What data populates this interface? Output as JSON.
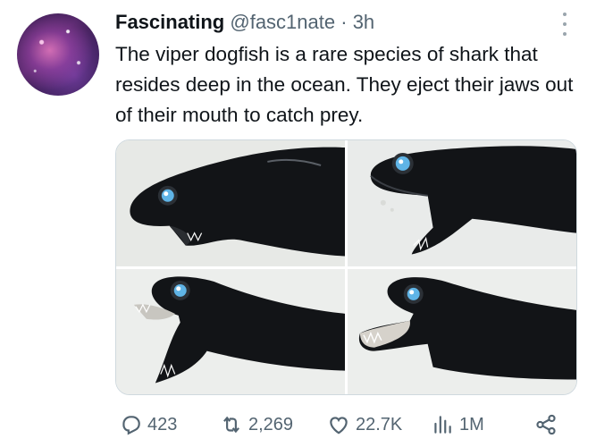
{
  "author": {
    "name": "Fascinating",
    "handle": "@fasc1nate",
    "separator": "·",
    "time": "3h",
    "avatar": "galaxy-avatar"
  },
  "tweet": {
    "text": "The viper dogfish is a rare species of shark that resides deep in the ocean. They eject their jaws out of their mouth to catch prey."
  },
  "media": {
    "photos": [
      "viper-dogfish-jaws-closed",
      "viper-dogfish-jaws-opening",
      "viper-dogfish-jaws-open",
      "viper-dogfish-jaws-ejected"
    ]
  },
  "metrics": {
    "replies": "423",
    "retweets": "2,269",
    "likes": "22.7K",
    "views": "1M"
  },
  "icons": {
    "reply": "reply-icon",
    "retweet": "retweet-icon",
    "like": "heart-icon",
    "views": "views-icon",
    "share": "share-icon",
    "more": "more-icon"
  },
  "colors": {
    "text": "#0f1419",
    "secondary": "#536471",
    "shark": "#15171a",
    "eye": "#4aa8e0"
  }
}
